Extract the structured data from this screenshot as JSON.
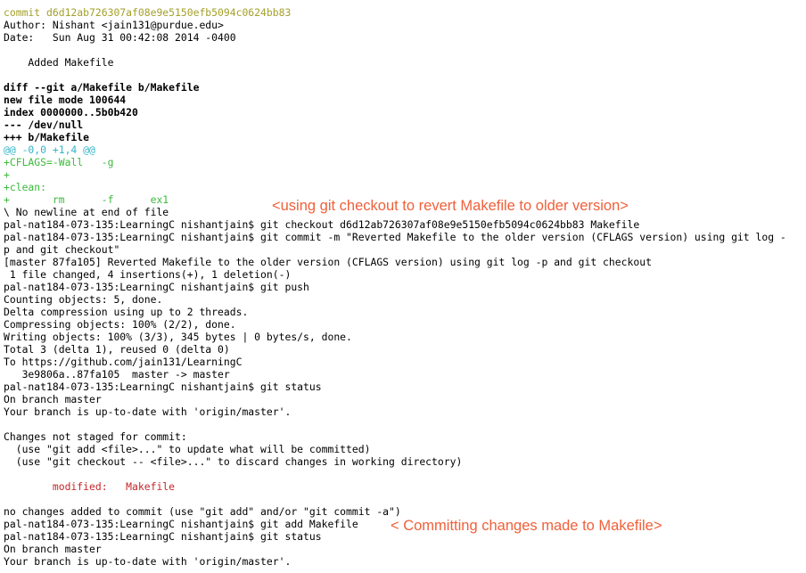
{
  "colors": {
    "commit_hash": "#a4a02a",
    "hunk_header": "#32b4c8",
    "added_line": "#3cb93c",
    "modified": "#c5262a",
    "annotation": "#f0603a",
    "background": "#ffffff",
    "text": "#000000"
  },
  "terminal": {
    "lines": [
      {
        "text": "commit d6d12ab726307af08e9e5150efb5094c0624bb83",
        "style": "yellow"
      },
      {
        "text": "Author: Nishant <jain131@purdue.edu>",
        "style": "plain"
      },
      {
        "text": "Date:   Sun Aug 31 00:42:08 2014 -0400",
        "style": "plain"
      },
      {
        "text": "",
        "style": "plain"
      },
      {
        "text": "    Added Makefile",
        "style": "plain"
      },
      {
        "text": "",
        "style": "plain"
      },
      {
        "text": "diff --git a/Makefile b/Makefile",
        "style": "bold"
      },
      {
        "text": "new file mode 100644",
        "style": "bold"
      },
      {
        "text": "index 0000000..5b0b420",
        "style": "bold"
      },
      {
        "text": "--- /dev/null",
        "style": "bold"
      },
      {
        "text": "+++ b/Makefile",
        "style": "bold"
      },
      {
        "text": "@@ -0,0 +1,4 @@",
        "style": "cyan"
      },
      {
        "text": "+CFLAGS=-Wall   -g",
        "style": "green"
      },
      {
        "text": "+",
        "style": "green"
      },
      {
        "text": "+clean:",
        "style": "green"
      },
      {
        "text": "+       rm      -f      ex1",
        "style": "green"
      },
      {
        "text": "\\ No newline at end of file",
        "style": "plain"
      },
      {
        "text": "pal-nat184-073-135:LearningC nishantjain$ git checkout d6d12ab726307af08e9e5150efb5094c0624bb83 Makefile",
        "style": "plain"
      },
      {
        "text": "pal-nat184-073-135:LearningC nishantjain$ git commit -m \"Reverted Makefile to the older version (CFLAGS version) using git log -",
        "style": "plain"
      },
      {
        "text": "p and git checkout\"",
        "style": "plain"
      },
      {
        "text": "[master 87fa105] Reverted Makefile to the older version (CFLAGS version) using git log -p and git checkout",
        "style": "plain"
      },
      {
        "text": " 1 file changed, 4 insertions(+), 1 deletion(-)",
        "style": "plain"
      },
      {
        "text": "pal-nat184-073-135:LearningC nishantjain$ git push",
        "style": "plain"
      },
      {
        "text": "Counting objects: 5, done.",
        "style": "plain"
      },
      {
        "text": "Delta compression using up to 2 threads.",
        "style": "plain"
      },
      {
        "text": "Compressing objects: 100% (2/2), done.",
        "style": "plain"
      },
      {
        "text": "Writing objects: 100% (3/3), 345 bytes | 0 bytes/s, done.",
        "style": "plain"
      },
      {
        "text": "Total 3 (delta 1), reused 0 (delta 0)",
        "style": "plain"
      },
      {
        "text": "To https://github.com/jain131/LearningC",
        "style": "plain"
      },
      {
        "text": "   3e9806a..87fa105  master -> master",
        "style": "plain"
      },
      {
        "text": "pal-nat184-073-135:LearningC nishantjain$ git status",
        "style": "plain"
      },
      {
        "text": "On branch master",
        "style": "plain"
      },
      {
        "text": "Your branch is up-to-date with 'origin/master'.",
        "style": "plain"
      },
      {
        "text": "",
        "style": "plain"
      },
      {
        "text": "Changes not staged for commit:",
        "style": "plain"
      },
      {
        "text": "  (use \"git add <file>...\" to update what will be committed)",
        "style": "plain"
      },
      {
        "text": "  (use \"git checkout -- <file>...\" to discard changes in working directory)",
        "style": "plain"
      },
      {
        "text": "",
        "style": "plain"
      },
      {
        "text": "        modified:   Makefile",
        "style": "red"
      },
      {
        "text": "",
        "style": "plain"
      },
      {
        "text": "no changes added to commit (use \"git add\" and/or \"git commit -a\")",
        "style": "plain"
      },
      {
        "text": "pal-nat184-073-135:LearningC nishantjain$ git add Makefile",
        "style": "plain"
      },
      {
        "text": "pal-nat184-073-135:LearningC nishantjain$ git status",
        "style": "plain"
      },
      {
        "text": "On branch master",
        "style": "plain"
      },
      {
        "text": "Your branch is up-to-date with 'origin/master'.",
        "style": "plain"
      }
    ]
  },
  "annotations": {
    "checkout_note": "<using git checkout to revert Makefile to older version>",
    "commit_note": "< Committing changes made to Makefile>"
  }
}
